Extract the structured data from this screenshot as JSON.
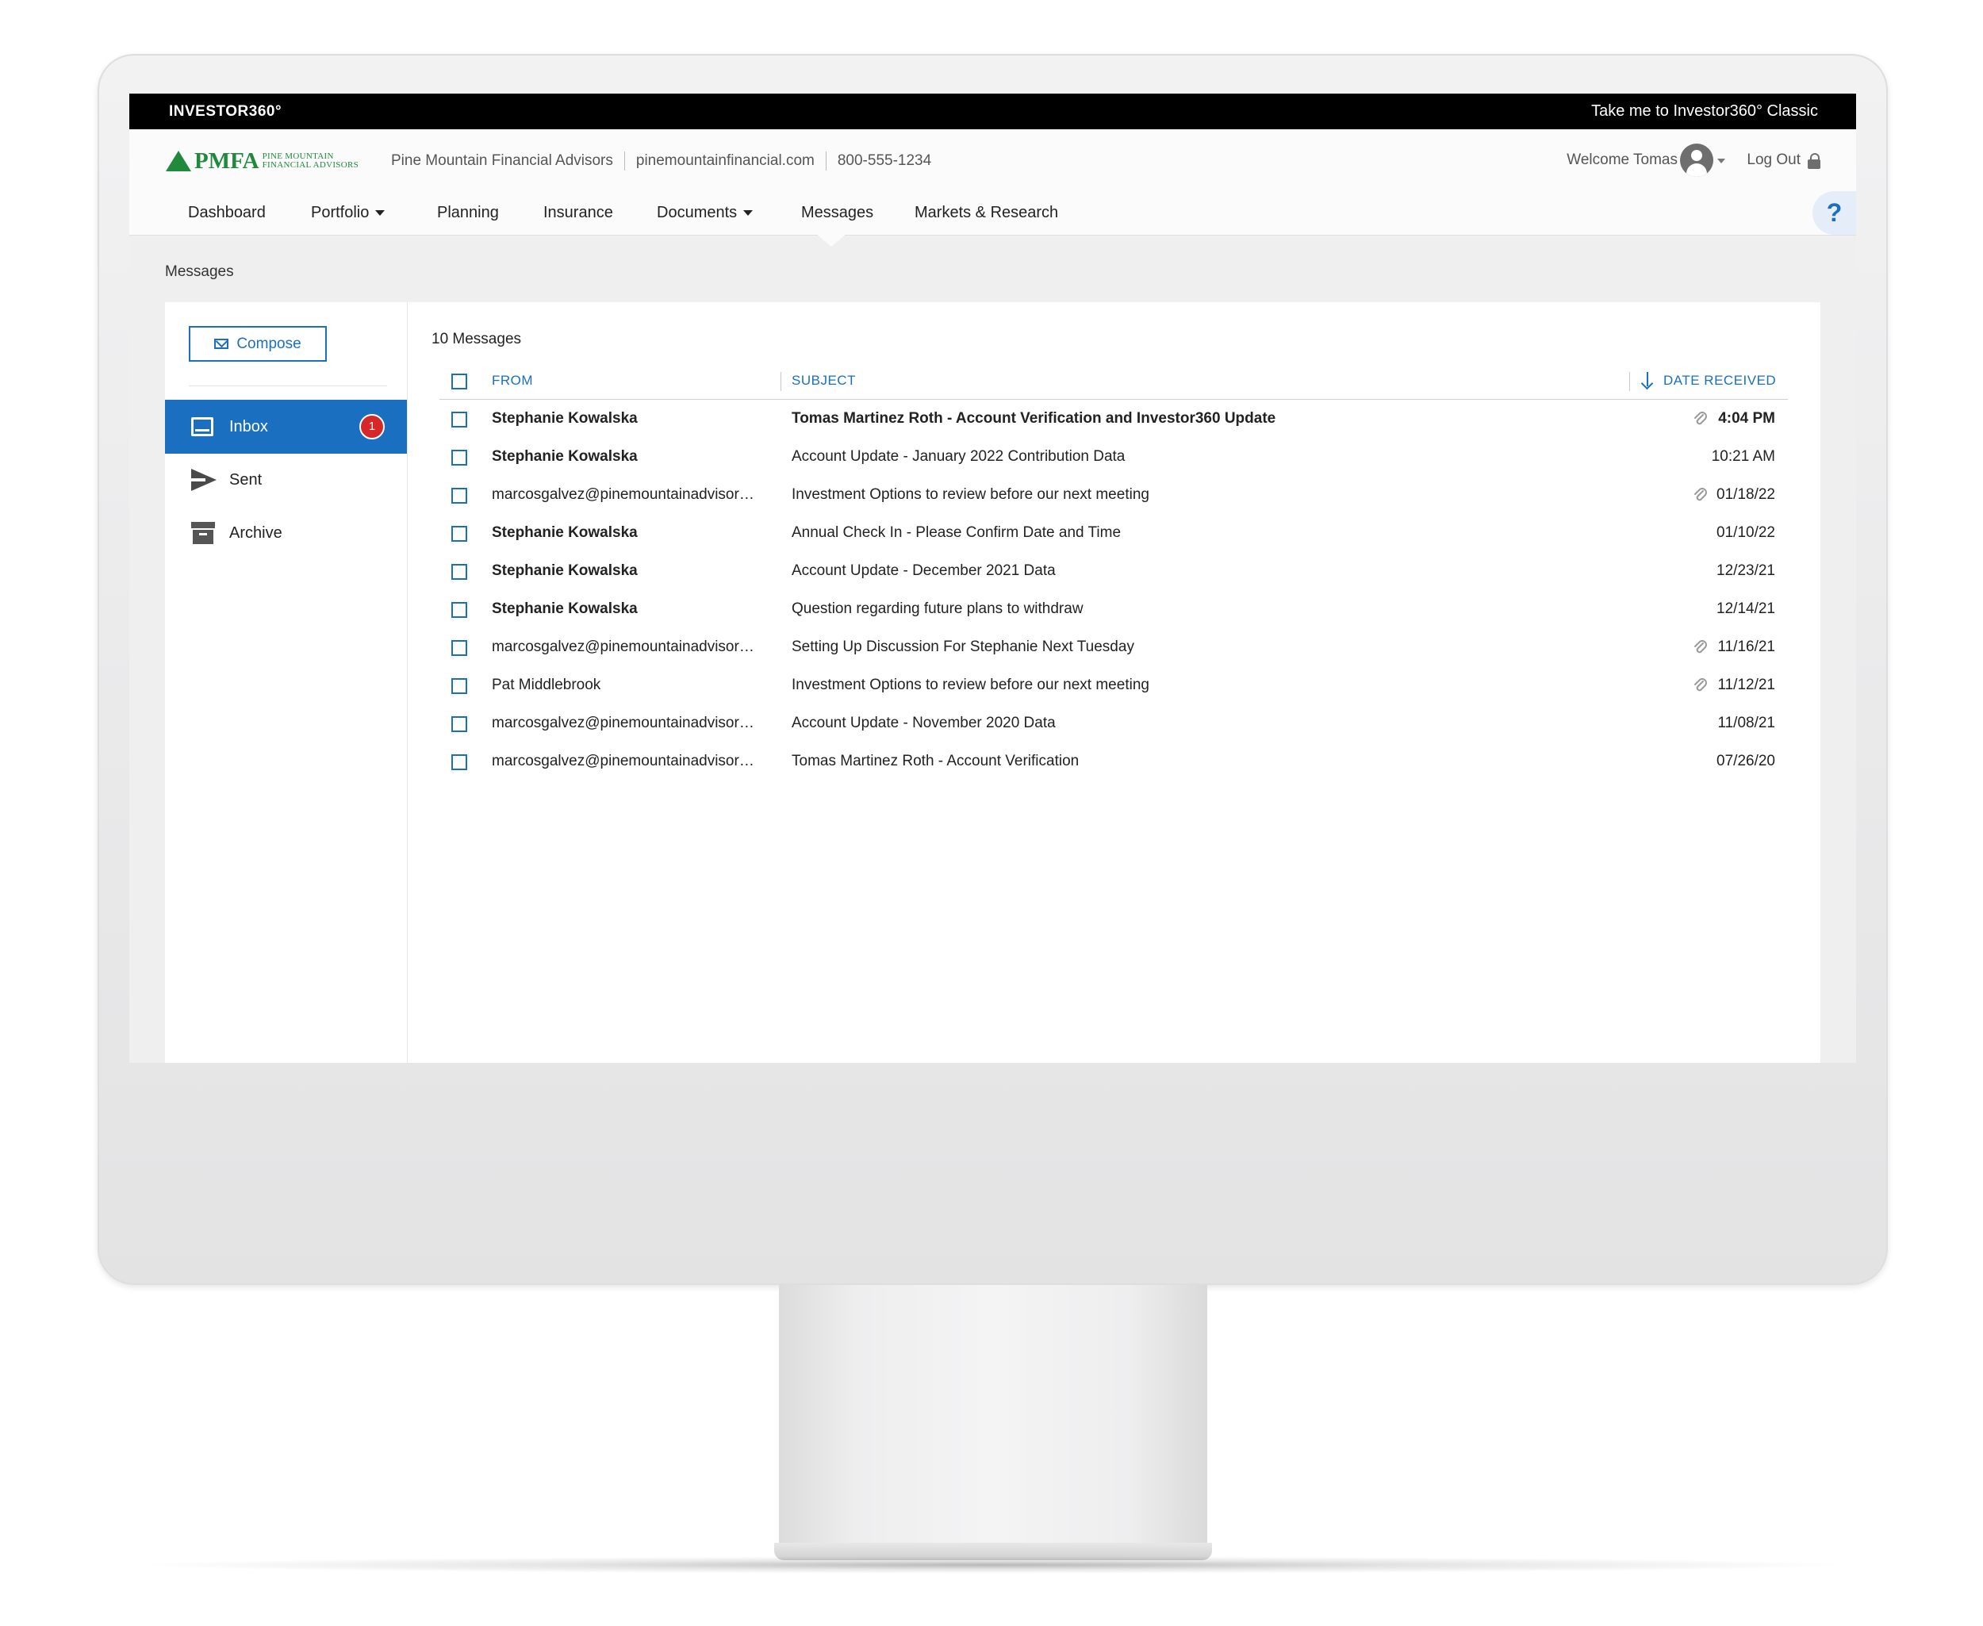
{
  "topbar": {
    "brand": "INVESTOR360°",
    "classic_link": "Take me to Investor360° Classic"
  },
  "header": {
    "logo_text": "PMFA",
    "logo_subtext_1": "PINE MOUNTAIN",
    "logo_subtext_2": "FINANCIAL ADVISORS",
    "firm_name": "Pine Mountain Financial Advisors",
    "website": "pinemountainfinancial.com",
    "phone": "800-555-1234",
    "welcome": "Welcome Tomas",
    "logout": "Log Out"
  },
  "nav": {
    "items": [
      {
        "label": "Dashboard"
      },
      {
        "label": "Portfolio"
      },
      {
        "label": "Planning"
      },
      {
        "label": "Insurance"
      },
      {
        "label": "Documents"
      },
      {
        "label": "Messages"
      },
      {
        "label": "Markets & Research"
      }
    ],
    "active": "Messages",
    "help": "?"
  },
  "page": {
    "title": "Messages"
  },
  "sidebar": {
    "compose": "Compose",
    "items": [
      {
        "label": "Inbox",
        "badge": "1"
      },
      {
        "label": "Sent"
      },
      {
        "label": "Archive"
      }
    ]
  },
  "messages": {
    "count_label": "10 Messages",
    "columns": {
      "from": "FROM",
      "subject": "SUBJECT",
      "date": "DATE RECEIVED"
    },
    "rows": [
      {
        "from": "Stephanie Kowalska",
        "subject": "Tomas Martinez Roth - Account Verification and Investor360 Update",
        "date": "4:04 PM",
        "attachment": true,
        "unread": true
      },
      {
        "from": "Stephanie Kowalska",
        "subject": "Account Update - January 2022  Contribution Data",
        "date": "10:21 AM",
        "attachment": false,
        "unread": false
      },
      {
        "from": "marcosgalvez@pinemountainadvisor…",
        "subject": "Investment Options to review before our next meeting",
        "date": "01/18/22",
        "attachment": true,
        "unread": false
      },
      {
        "from": "Stephanie Kowalska",
        "subject": "Annual Check In - Please Confirm Date and Time",
        "date": "01/10/22",
        "attachment": false,
        "unread": false
      },
      {
        "from": "Stephanie Kowalska",
        "subject": "Account Update - December 2021  Data",
        "date": "12/23/21",
        "attachment": false,
        "unread": false
      },
      {
        "from": "Stephanie Kowalska",
        "subject": "Question regarding future plans to withdraw",
        "date": "12/14/21",
        "attachment": false,
        "unread": false
      },
      {
        "from": "marcosgalvez@pinemountainadvisor…",
        "subject": "Setting Up Discussion For Stephanie Next Tuesday",
        "date": "11/16/21",
        "attachment": true,
        "unread": false
      },
      {
        "from": "Pat Middlebrook",
        "subject": "Investment Options to review before our next meeting",
        "date": "11/12/21",
        "attachment": true,
        "unread": false
      },
      {
        "from": "marcosgalvez@pinemountainadvisor…",
        "subject": "Account Update - November 2020  Data",
        "date": "11/08/21",
        "attachment": false,
        "unread": false
      },
      {
        "from": "marcosgalvez@pinemountainadvisor…",
        "subject": "Tomas Martinez Roth - Account Verification",
        "date": "07/26/20",
        "attachment": false,
        "unread": false
      }
    ]
  },
  "colors": {
    "accent": "#1a6fc0",
    "brand_green": "#1f8a3c",
    "badge_red": "#d62828",
    "topbar": "#000000"
  }
}
